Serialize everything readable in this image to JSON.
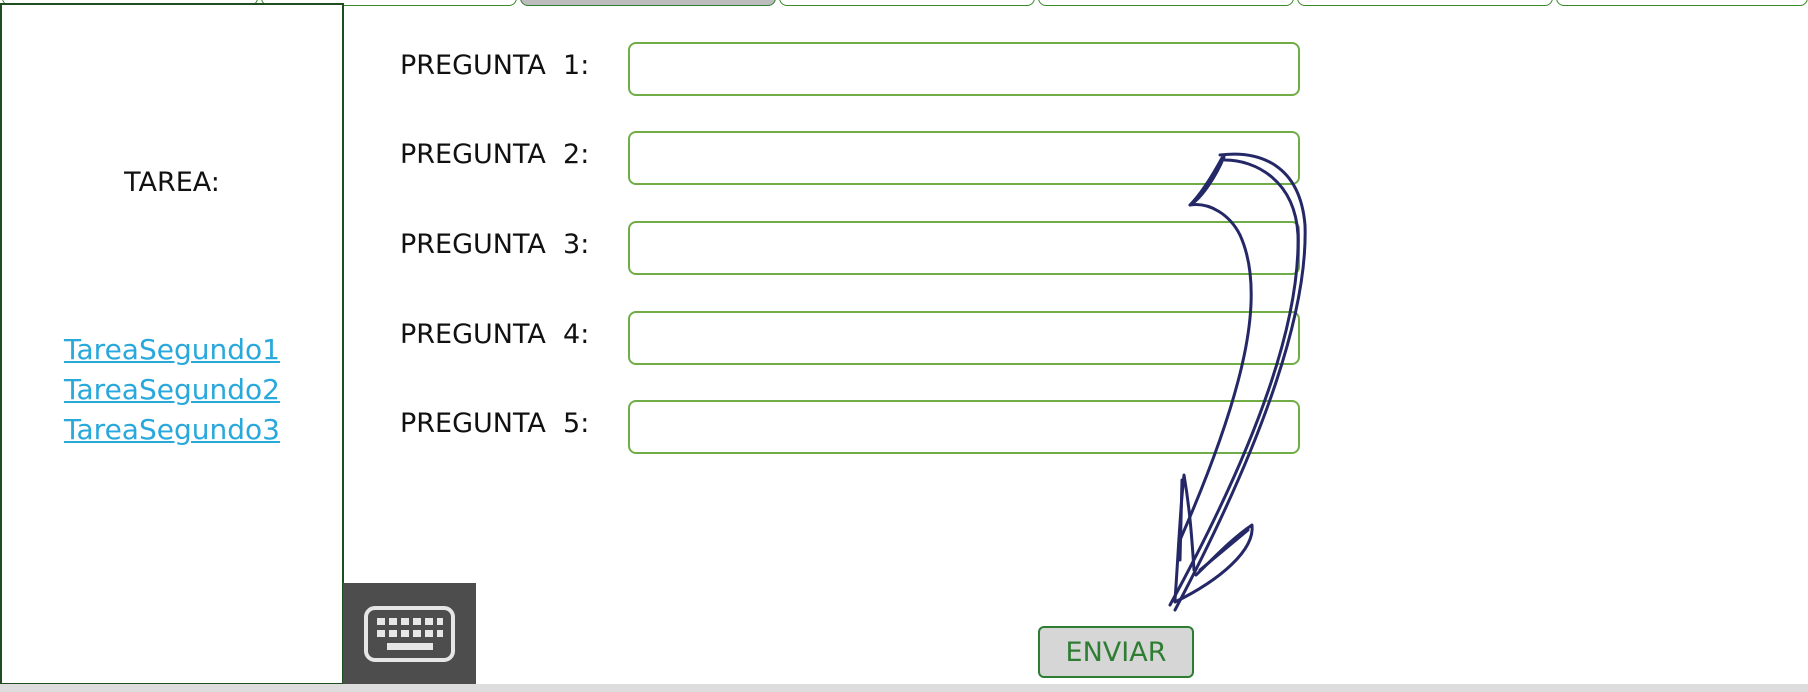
{
  "sidebar": {
    "title": "TAREA:",
    "links": [
      "TareaSegundo1",
      "TareaSegundo2",
      "TareaSegundo3"
    ]
  },
  "questions": [
    {
      "label": "PREGUNTA  1:",
      "value": ""
    },
    {
      "label": "PREGUNTA  2:",
      "value": ""
    },
    {
      "label": "PREGUNTA  3:",
      "value": ""
    },
    {
      "label": "PREGUNTA  4:",
      "value": ""
    },
    {
      "label": "PREGUNTA  5:",
      "value": ""
    }
  ],
  "submit_label": "ENVIAR",
  "icons": {
    "keyboard": "keyboard-icon",
    "arrow": "hand-drawn-arrow"
  },
  "colors": {
    "accent_green": "#70ad47",
    "dark_green": "#2e7d32",
    "link_blue": "#29a8dc",
    "arrow_navy": "#252866"
  }
}
